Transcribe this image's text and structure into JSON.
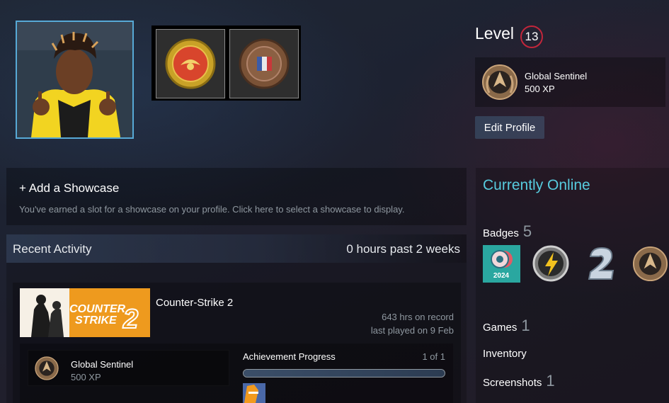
{
  "profile": {
    "level_label": "Level",
    "level": "13",
    "favorite_badge": {
      "name": "Global Sentinel",
      "xp": "500 XP"
    },
    "edit_button": "Edit Profile",
    "profile_badges": [
      "csgo-gold-coin-icon",
      "esl-major-bronze-coin-icon"
    ]
  },
  "showcase": {
    "title": "+ Add a Showcase",
    "description": "You've earned a slot for a showcase on your profile. Click here to select a showcase to display."
  },
  "recent_activity": {
    "title": "Recent Activity",
    "hours": "0 hours past 2 weeks",
    "game": {
      "name": "Counter-Strike 2",
      "capsule_line1": "COUNTER",
      "capsule_line2": "STRIKE",
      "capsule_num": "2",
      "hours_on_record": "643 hrs on record",
      "last_played": "last played on 9 Feb",
      "badge": {
        "name": "Global Sentinel",
        "xp": "500 XP"
      },
      "achievement_title": "Achievement Progress",
      "achievement_count": "1 of 1",
      "achievement_progress": 1.0
    }
  },
  "sidebar": {
    "status": "Currently Online",
    "badges_label": "Badges",
    "badges_count": "5",
    "badge_icons": [
      "steam-2024-badge-icon",
      "lightning-coin-badge-icon",
      "cs2-badge-icon",
      "global-sentinel-badge-icon"
    ],
    "steam_badge_year": "2024",
    "games_label": "Games",
    "games_count": "1",
    "inventory_label": "Inventory",
    "screenshots_label": "Screenshots",
    "screenshots_count": "1"
  },
  "colors": {
    "accent": "#57cbde",
    "level_ring": "#c2263b",
    "avatar_border": "#57a9d6"
  }
}
